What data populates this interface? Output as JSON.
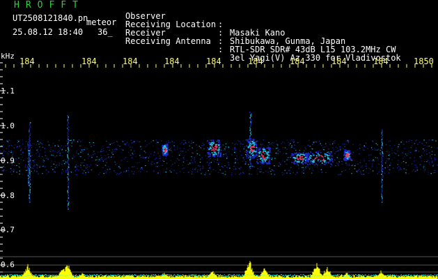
{
  "header": {
    "logo": "HROFFT",
    "filename": "UT2508121840.pn",
    "filename_suffix": "meteor",
    "datetime": "25.08.12 18:40",
    "count": "36_"
  },
  "meta": [
    {
      "label": "Observer",
      "sep": ":",
      "value": "Masaki Kano"
    },
    {
      "label": "Receiving Location",
      "sep": ":",
      "value": "Shibukawa, Gunma, Japan"
    },
    {
      "label": "Receiver",
      "sep": ":",
      "value": "RTL-SDR SDR# 43dB L15 103.2MHz CW"
    },
    {
      "label": "Receiving Antenna",
      "sep": ":",
      "value": "3el Yagi(V) Az 330 for Vladivostok"
    }
  ],
  "axes": {
    "y_unit": "kHz",
    "y_ticks": [
      "1.1",
      "1.0",
      "0.9",
      "0.8",
      "0.7",
      "0.6"
    ],
    "x_ticks": [
      "184",
      "184",
      "184",
      "184",
      "184",
      "184",
      "184",
      "184",
      "184",
      "1850"
    ]
  },
  "colors": {
    "background": "#000000",
    "logo": "#2ecc40",
    "text": "#ffffff",
    "x_ticks": "#ffff66",
    "signal_low": "#1f2bd0",
    "signal_mid": "#22c5e8",
    "signal_high": "#ff3060",
    "power_trace": "#ffff00",
    "noise_floor": "#00ffff"
  }
}
